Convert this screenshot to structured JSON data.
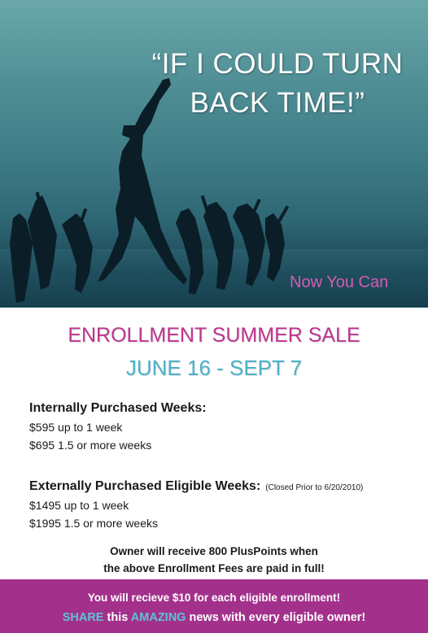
{
  "hero": {
    "quote_line1": "“IF I COULD TURN",
    "quote_line2": "BACK TIME!”",
    "tagline": "Now You Can"
  },
  "sale": {
    "title": "ENROLLMENT SUMMER SALE",
    "dates": "JUNE 16 - SEPT 7"
  },
  "internal": {
    "heading": "Internally Purchased Weeks:",
    "lines": [
      "$595 up to 1 week",
      "$695 1.5 or more weeks"
    ]
  },
  "external": {
    "heading": "Externally Purchased Eligible Weeks:",
    "note": "(Closed Prior to 6/20/2010)",
    "lines": [
      "$1495 up to 1 week",
      "$1995 1.5 or more weeks"
    ]
  },
  "owner": {
    "line1": "Owner will receive 800 PlusPoints when",
    "line2": "the above Enrollment Fees are paid in full!"
  },
  "footer": {
    "line1": "You will recieve $10 for each eligible enrollment!",
    "share": "SHARE",
    "this": " this ",
    "amazing": "AMAZING",
    "rest": " news with every eligible owner!"
  },
  "colors": {
    "magenta": "#c0338f",
    "teal": "#4bb2c8",
    "footer_bg": "#a3318c",
    "tagline": "#d65ab6"
  }
}
